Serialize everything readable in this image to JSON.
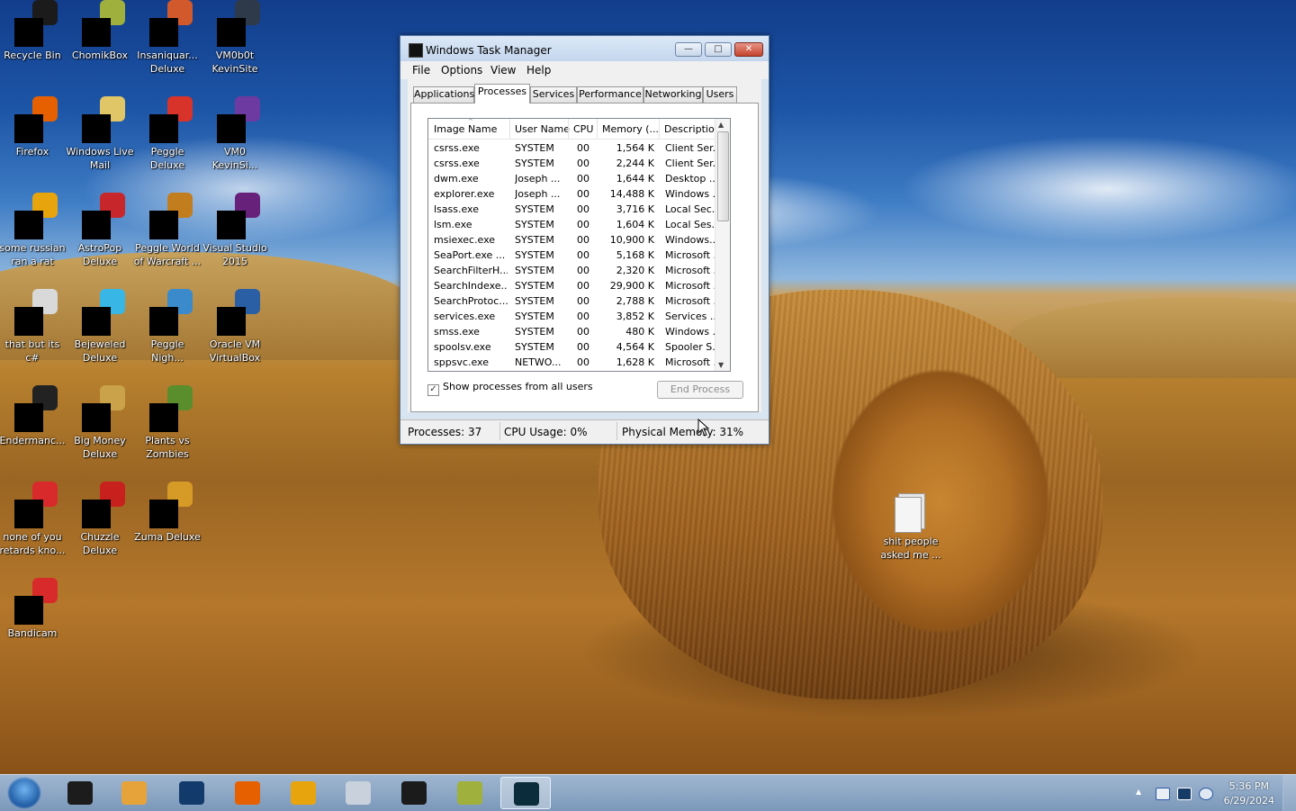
{
  "desktop": {
    "icons": [
      {
        "label": "Recycle Bin",
        "icon": "recycle-bin-icon",
        "color": "#1b1b1b"
      },
      {
        "label": "ChomikBox",
        "icon": "chomikbox-icon",
        "color": "#9fb13c"
      },
      {
        "label": "Insaniquar... Deluxe",
        "icon": "insaniquarium-icon",
        "color": "#d2592b"
      },
      {
        "label": "VM0b0t KevinSite",
        "icon": "vm-icon",
        "color": "#2e3a4a"
      },
      {
        "label": "Firefox",
        "icon": "firefox-icon",
        "color": "#e66000"
      },
      {
        "label": "Windows Live Mail",
        "icon": "windows-live-mail-icon",
        "color": "#e1c667"
      },
      {
        "label": "Peggle Deluxe",
        "icon": "peggle-icon",
        "color": "#d7332a"
      },
      {
        "label": "VM0 KevinSi...",
        "icon": "vm-icon",
        "color": "#6d3aa1"
      },
      {
        "label": "some russian ran a rat",
        "icon": "document-icon",
        "color": "#e8a40d"
      },
      {
        "label": "AstroPop Deluxe",
        "icon": "astropop-icon",
        "color": "#c7262a"
      },
      {
        "label": "Peggle World of Warcraft ...",
        "icon": "peggle-icon",
        "color": "#c27d1e"
      },
      {
        "label": "Visual Studio 2015",
        "icon": "visual-studio-icon",
        "color": "#68217a"
      },
      {
        "label": "that but its c#",
        "icon": "files-icon",
        "color": "#d9d9d9"
      },
      {
        "label": "Bejeweled Deluxe",
        "icon": "bejeweled-icon",
        "color": "#38b6e6"
      },
      {
        "label": "Peggle Nigh...",
        "icon": "peggle-icon",
        "color": "#3b8bcc"
      },
      {
        "label": "Oracle VM VirtualBox",
        "icon": "virtualbox-icon",
        "color": "#2a5fa5"
      },
      {
        "label": "Endermanc...",
        "icon": "terminal-icon",
        "color": "#222"
      },
      {
        "label": "Big Money Deluxe",
        "icon": "big-money-icon",
        "color": "#c9a24a"
      },
      {
        "label": "Plants vs Zombies",
        "icon": "plants-vs-zombies-icon",
        "color": "#5a8e2c"
      },
      {
        "label": "none of you retards kno...",
        "icon": "bandicam-icon",
        "color": "#d82a2a"
      },
      {
        "label": "Chuzzle Deluxe",
        "icon": "chuzzle-icon",
        "color": "#c8211d"
      },
      {
        "label": "Zuma Deluxe",
        "icon": "zuma-icon",
        "color": "#d69a26"
      },
      {
        "label": "Bandicam",
        "icon": "bandicam-icon",
        "color": "#d82a2a"
      }
    ],
    "floating_icon": {
      "label": "shit people asked me ...",
      "icon": "file-icon",
      "color": "#dcdcdc"
    }
  },
  "task_manager": {
    "title": "Windows Task Manager",
    "buttons": {
      "minimize": "—",
      "maximize": "□",
      "close": "✕"
    },
    "menu": [
      "File",
      "Options",
      "View",
      "Help"
    ],
    "tabs": [
      "Applications",
      "Processes",
      "Services",
      "Performance",
      "Networking",
      "Users"
    ],
    "active_tab": "Processes",
    "columns": [
      "Image Name",
      "User Name",
      "CPU",
      "Memory (...",
      "Description"
    ],
    "rows": [
      [
        "csrss.exe",
        "SYSTEM",
        "00",
        "1,564 K",
        "Client Ser..."
      ],
      [
        "csrss.exe",
        "SYSTEM",
        "00",
        "2,244 K",
        "Client Ser..."
      ],
      [
        "dwm.exe",
        "Joseph ...",
        "00",
        "1,644 K",
        "Desktop ..."
      ],
      [
        "explorer.exe",
        "Joseph ...",
        "00",
        "14,488 K",
        "Windows ..."
      ],
      [
        "lsass.exe",
        "SYSTEM",
        "00",
        "3,716 K",
        "Local Sec..."
      ],
      [
        "lsm.exe",
        "SYSTEM",
        "00",
        "1,604 K",
        "Local Ses..."
      ],
      [
        "msiexec.exe",
        "SYSTEM",
        "00",
        "10,900 K",
        "Windows..."
      ],
      [
        "SeaPort.exe ...",
        "SYSTEM",
        "00",
        "5,168 K",
        "Microsoft ..."
      ],
      [
        "SearchFilterH...",
        "SYSTEM",
        "00",
        "2,320 K",
        "Microsoft ..."
      ],
      [
        "SearchIndexe...",
        "SYSTEM",
        "00",
        "29,900 K",
        "Microsoft ..."
      ],
      [
        "SearchProtoc...",
        "SYSTEM",
        "00",
        "2,788 K",
        "Microsoft ..."
      ],
      [
        "services.exe",
        "SYSTEM",
        "00",
        "3,852 K",
        "Services ..."
      ],
      [
        "smss.exe",
        "SYSTEM",
        "00",
        "480 K",
        "Windows ..."
      ],
      [
        "spoolsv.exe",
        "SYSTEM",
        "00",
        "4,564 K",
        "Spooler S..."
      ],
      [
        "sppsvc.exe",
        "NETWO...",
        "00",
        "1,628 K",
        "Microsoft ..."
      ]
    ],
    "show_all_label": "Show processes from all users",
    "show_all_checked": true,
    "end_process_label": "End Process",
    "status": {
      "processes": "Processes: 37",
      "cpu": "CPU Usage: 0%",
      "memory": "Physical Memory: 31%"
    }
  },
  "taskbar": {
    "pinned": [
      {
        "name": "cmd-icon",
        "color": "#1c1c1c"
      },
      {
        "name": "media-player-icon",
        "color": "#e6a33a"
      },
      {
        "name": "firefox-dark-icon",
        "color": "#123a6a"
      },
      {
        "name": "firefox-icon",
        "color": "#e66000"
      },
      {
        "name": "document-icon",
        "color": "#e8a40d"
      },
      {
        "name": "files-icon",
        "color": "#c9d1dc"
      },
      {
        "name": "terminal-icon",
        "color": "#1b1b1b"
      },
      {
        "name": "chomikbox-icon",
        "color": "#9fb13c"
      },
      {
        "name": "task-manager-icon",
        "color": "#0b2c3a"
      }
    ],
    "active_index": 8,
    "tray": [
      "show-hidden-icons",
      "action-center-icon",
      "monitor-icon",
      "network-icon"
    ],
    "time": "5:36 PM",
    "date": "6/29/2024"
  }
}
